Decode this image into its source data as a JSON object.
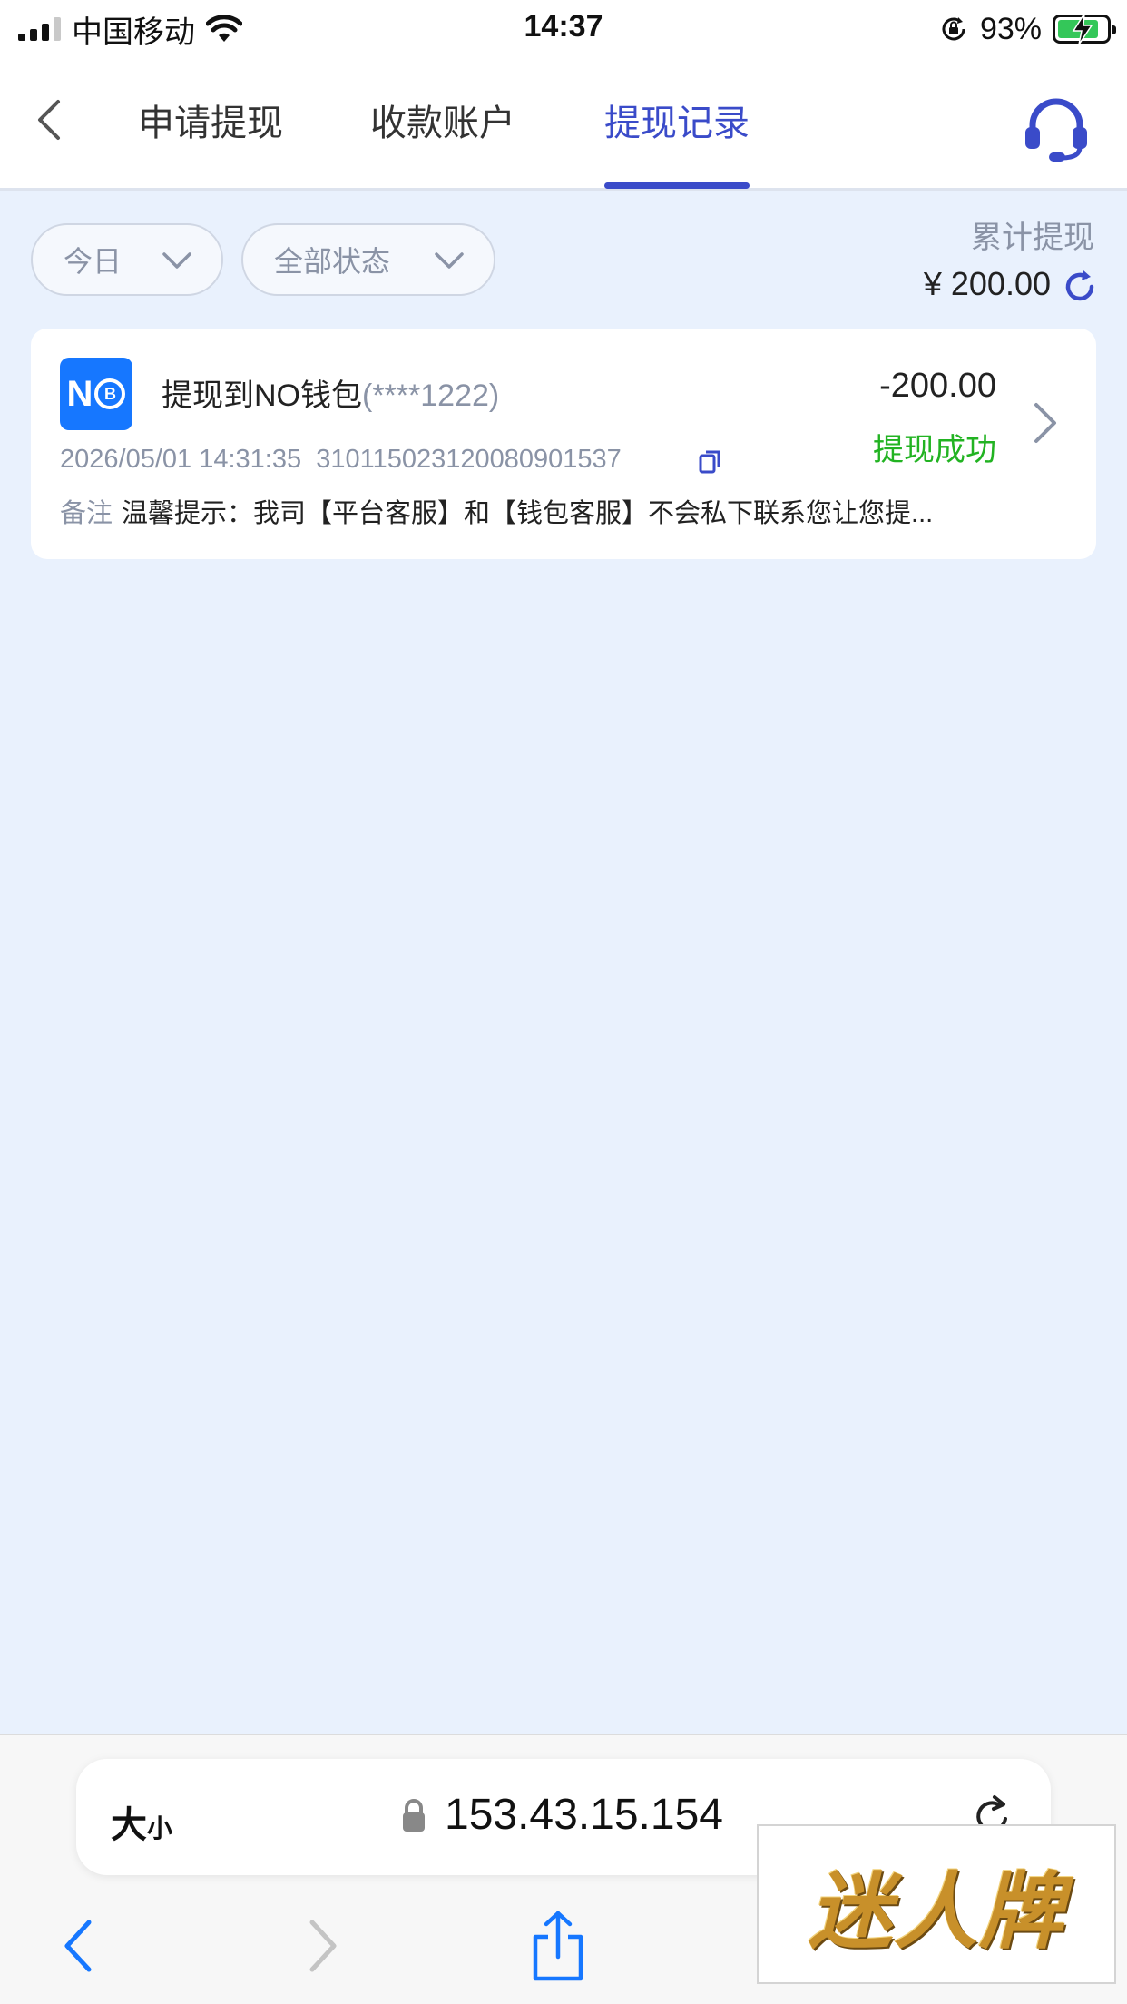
{
  "status_bar": {
    "carrier": "中国移动",
    "time": "14:37",
    "battery": "93%"
  },
  "header": {
    "tabs": [
      {
        "label": "申请提现",
        "active": false
      },
      {
        "label": "收款账户",
        "active": false
      },
      {
        "label": "提现记录",
        "active": true
      }
    ]
  },
  "filters": {
    "date": "今日",
    "status": "全部状态"
  },
  "summary": {
    "label": "累计提现",
    "amount": "¥ 200.00"
  },
  "records": [
    {
      "title": "提现到NO钱包",
      "account": "(****1222)",
      "amount": "-200.00",
      "status": "提现成功",
      "datetime": "2026/05/01 14:31:35",
      "order_no": "310115023120080901537",
      "note_label": "备注",
      "note": "温馨提示：我司【平台客服】和【钱包客服】不会私下联系您让您提..."
    }
  ],
  "browser": {
    "text_size_big": "大",
    "text_size_small": "小",
    "url": "153.43.15.154"
  },
  "watermark": "迷人牌",
  "colors": {
    "accent": "#3a4bc9",
    "success": "#22b322",
    "background": "#e9f1fd",
    "wallet_blue": "#1677ff"
  }
}
